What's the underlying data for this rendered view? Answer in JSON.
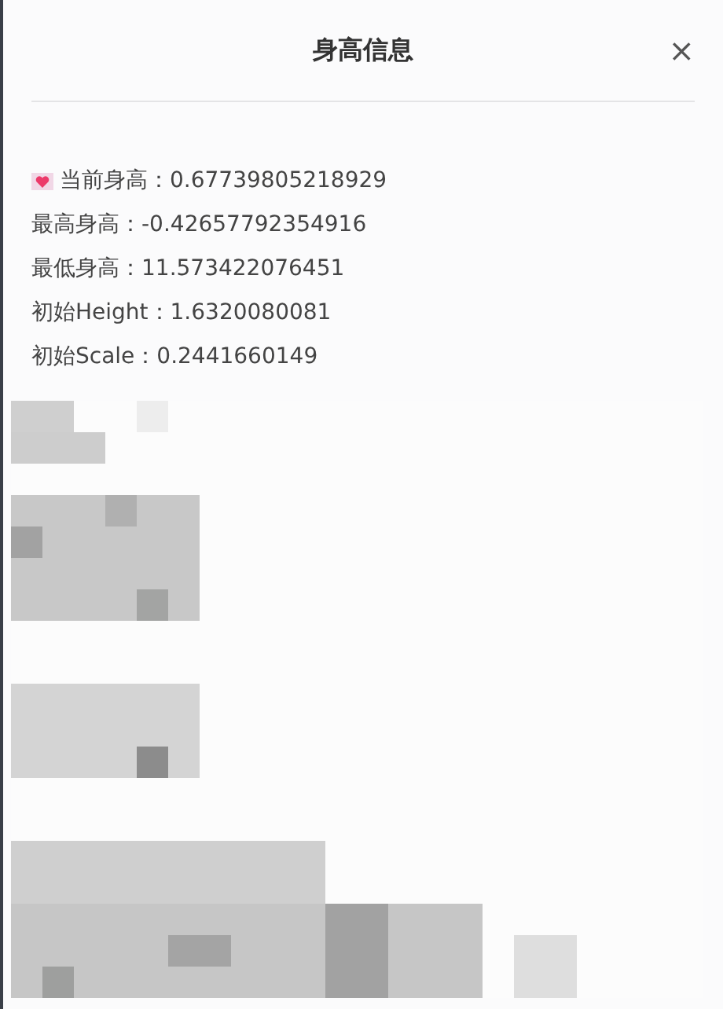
{
  "dialog": {
    "title": "身高信息",
    "close": "×"
  },
  "lines": [
    {
      "text": "当前身高：0.67739805218929",
      "kind": "marked"
    },
    {
      "text": "最高身高：-0.42657792354916",
      "kind": "plain"
    },
    {
      "text": "最低身高：11.573422076451",
      "kind": "plain"
    },
    {
      "text": "初始Height：1.6320080081",
      "kind": "plain"
    },
    {
      "text": "初始Scale：0.2441660149",
      "kind": "plain"
    }
  ]
}
